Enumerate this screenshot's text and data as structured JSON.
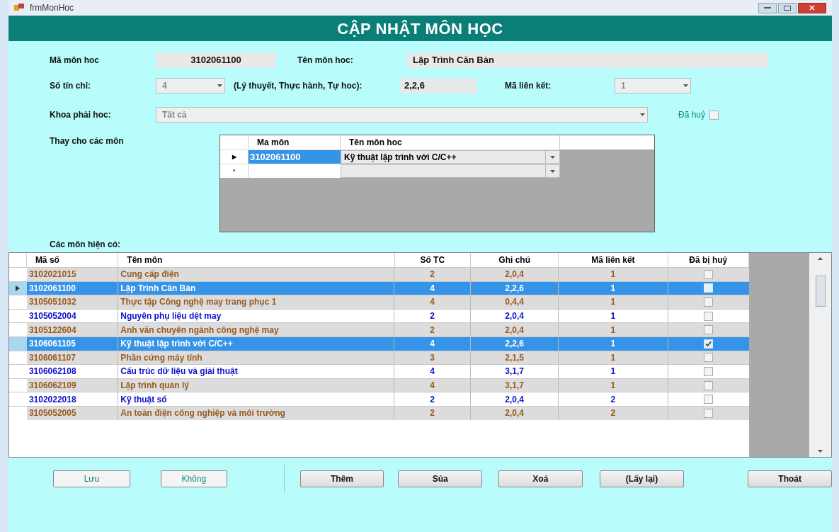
{
  "window": {
    "title": "frmMonHoc"
  },
  "header": "CẬP NHẬT MÔN HỌC",
  "form": {
    "ma_mon_hoc": {
      "label": "Mã môn hoc",
      "value": "3102061100"
    },
    "ten_mon_hoc": {
      "label": "Tên môn hoc:",
      "value": "Lập Trình Căn Bản"
    },
    "so_tin_chi": {
      "label": "Số tín chỉ:",
      "value": "4"
    },
    "ly_thuyet": {
      "label": "(Lý thuyết, Thực hành, Tự hoc):",
      "value": "2,2,6"
    },
    "ma_lien_ket": {
      "label": "Mã liên kết:",
      "value": "1"
    },
    "khoa": {
      "label": "Khoa phải hoc:",
      "value": "Tất cả"
    },
    "da_huy": {
      "label": "Đã huỷ",
      "checked": false
    }
  },
  "replace": {
    "label": "Thay cho các môn",
    "columns": [
      "Ma môn",
      "Tên môn hoc"
    ],
    "rows": [
      {
        "marker": "▶",
        "ma": "3102061100",
        "ten": "Kỹ thuật lập trình với C/C++"
      },
      {
        "marker": "*",
        "ma": "",
        "ten": ""
      }
    ]
  },
  "list_label": "Các môn hiện có:",
  "table": {
    "columns": [
      "Mã số",
      "Tên môn",
      "Số TC",
      "Ghi chú",
      "Mã liên kết",
      "Đã bị huỷ"
    ],
    "rows": [
      {
        "code": "3102021015",
        "name": "Cung cấp điện",
        "tc": "2",
        "note": "2,0,4",
        "link": "1",
        "cancelled": false,
        "shaded": true,
        "selected": false,
        "current": false
      },
      {
        "code": "3102061100",
        "name": "Lập Trình Căn Bản",
        "tc": "4",
        "note": "2,2,6",
        "link": "1",
        "cancelled": false,
        "selected": true,
        "current": true
      },
      {
        "code": "3105051032",
        "name": "Thực tập Công nghệ may trang phục 1",
        "tc": "4",
        "note": "0,4,4",
        "link": "1",
        "cancelled": false,
        "shaded": true,
        "selected": false,
        "current": false
      },
      {
        "code": "3105052004",
        "name": "Nguyên phụ liệu dệt may",
        "tc": "2",
        "note": "2,0,4",
        "link": "1",
        "cancelled": false,
        "shaded": false,
        "selected": false,
        "current": false
      },
      {
        "code": "3105122604",
        "name": "Anh văn chuyên ngành công nghệ may",
        "tc": "2",
        "note": "2,0,4",
        "link": "1",
        "cancelled": false,
        "shaded": true,
        "selected": false,
        "current": false
      },
      {
        "code": "3106061105",
        "name": "Kỹ thuật lập trình với C/C++",
        "tc": "4",
        "note": "2,2,6",
        "link": "1",
        "cancelled": true,
        "selected": true,
        "current": false
      },
      {
        "code": "3106061107",
        "name": "Phần cứng máy tính",
        "tc": "3",
        "note": "2,1,5",
        "link": "1",
        "cancelled": false,
        "shaded": true,
        "selected": false,
        "current": false
      },
      {
        "code": "3106062108",
        "name": "Cấu trúc dữ liệu và giải thuật",
        "tc": "4",
        "note": "3,1,7",
        "link": "1",
        "cancelled": false,
        "shaded": false,
        "selected": false,
        "current": false
      },
      {
        "code": "3106062109",
        "name": "Lập trình quản lý",
        "tc": "4",
        "note": "3,1,7",
        "link": "1",
        "cancelled": false,
        "shaded": true,
        "selected": false,
        "current": false
      },
      {
        "code": "3102022018",
        "name": "Kỹ thuật số",
        "tc": "2",
        "note": "2,0,4",
        "link": "2",
        "cancelled": false,
        "shaded": false,
        "selected": false,
        "current": false
      },
      {
        "code": "3105052005",
        "name": "An toàn điện công nghiệp và môi trường",
        "tc": "2",
        "note": "2,0,4",
        "link": "2",
        "cancelled": false,
        "shaded": true,
        "selected": false,
        "current": false
      }
    ]
  },
  "buttons": [
    {
      "label": "Lưu",
      "disabled": true
    },
    {
      "label": "Không",
      "disabled": true
    },
    {
      "label": "Thêm",
      "disabled": false
    },
    {
      "label": "Sủa",
      "disabled": false
    },
    {
      "label": "Xoá",
      "disabled": false
    },
    {
      "label": "(Lấy lại)",
      "disabled": false
    },
    {
      "label": "Thoát",
      "disabled": false
    }
  ]
}
